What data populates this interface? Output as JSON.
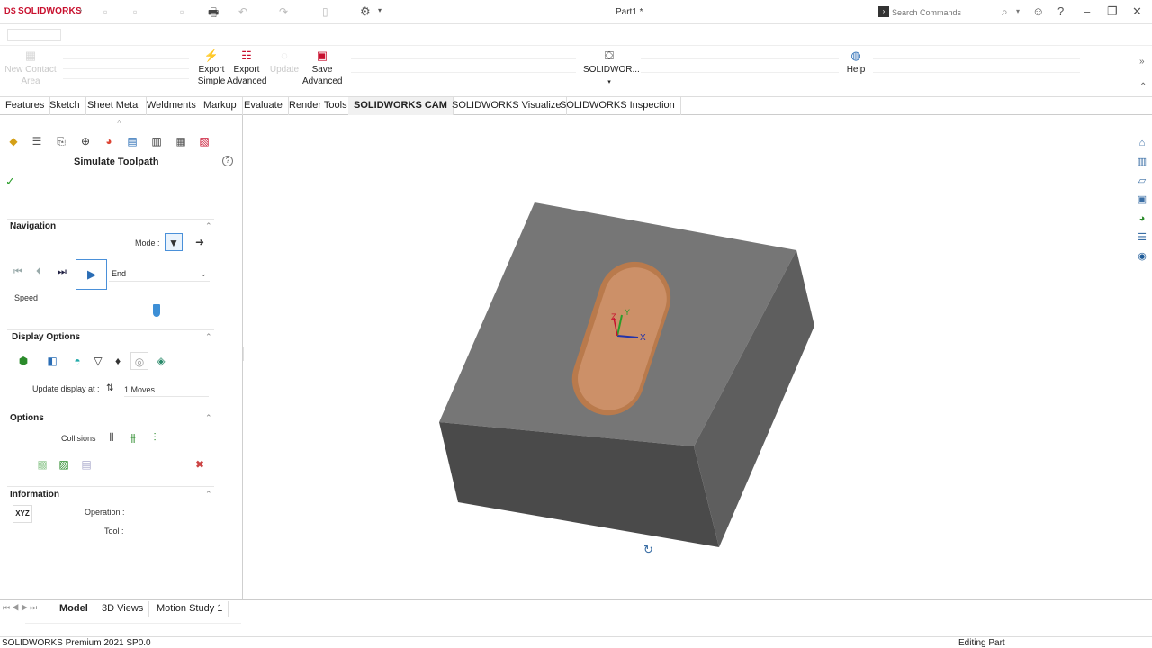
{
  "app": {
    "logo": "SOLIDWORKS",
    "doc_title": "Part1 *"
  },
  "search": {
    "placeholder": "Search Commands"
  },
  "ribbon": {
    "buttons": [
      {
        "label1": "New Contact",
        "label2": "Area",
        "faded": true
      },
      {
        "label1": "Export",
        "label2": "Simple",
        "faded": false
      },
      {
        "label1": "Export",
        "label2": "Advanced",
        "faded": false
      },
      {
        "label1": "Update",
        "label2": "",
        "faded": true
      },
      {
        "label1": "Save",
        "label2": "Advanced",
        "faded": false
      },
      {
        "label1": "SOLIDWOR...",
        "label2": "",
        "faded": false
      },
      {
        "label1": "Help",
        "label2": "",
        "faded": false
      }
    ]
  },
  "tabs": [
    "Features",
    "Sketch",
    "Sheet Metal",
    "Weldments",
    "Markup",
    "Evaluate",
    "Render Tools",
    "SOLIDWORKS CAM",
    "SOLIDWORKS Visualize",
    "SOLIDWORKS Inspection"
  ],
  "active_tab": "SOLIDWORKS CAM",
  "panel": {
    "title": "Simulate Toolpath",
    "navigation": {
      "header": "Navigation",
      "mode_label": "Mode :",
      "end_value": "End",
      "speed_label": "Speed",
      "speed_fraction": 0.9
    },
    "display_options": {
      "header": "Display Options",
      "update_label": "Update display at :",
      "update_value": "1 Moves"
    },
    "options": {
      "header": "Options",
      "collisions_label": "Collisions"
    },
    "information": {
      "header": "Information",
      "xyz_label": "XYZ",
      "operation_label": "Operation :",
      "tool_label": "Tool :"
    }
  },
  "triad": {
    "x": "X",
    "y": "Y",
    "z": "Z"
  },
  "bottom_tabs": [
    "Model",
    "3D Views",
    "Motion Study 1"
  ],
  "status": {
    "left": "SOLIDWORKS Premium 2021 SP0.0",
    "right": "Editing Part"
  },
  "colors": {
    "block": "#6b6b6b",
    "block_top": "#7a7a7a",
    "pocket": "#c88a5e",
    "accent": "#c8102e",
    "highlight_blue": "#4a90d9"
  }
}
